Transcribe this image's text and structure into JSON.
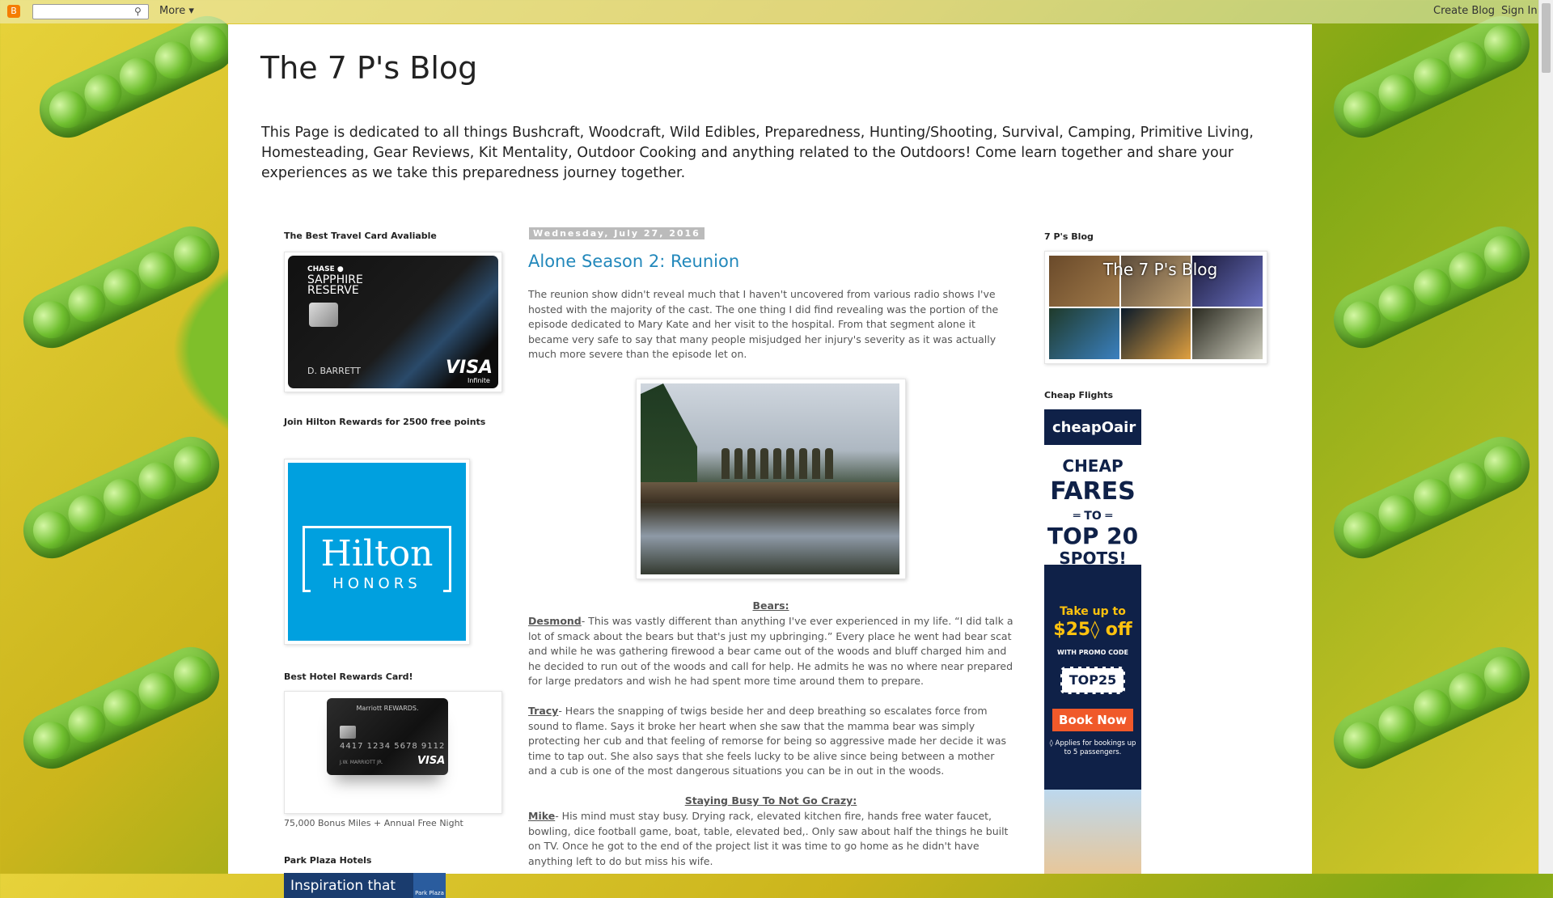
{
  "navbar": {
    "logo": "B",
    "more_label": "More ▾",
    "create_blog": "Create Blog",
    "sign_in": "Sign In",
    "search_icon": "search-icon"
  },
  "header": {
    "title": "The 7 P's Blog",
    "description": "This Page is dedicated to all things Bushcraft, Woodcraft, Wild Edibles, Preparedness, Hunting/Shooting, Survival, Camping, Primitive Living, Homesteading, Gear Reviews, Kit Mentality, Outdoor Cooking and anything related to the Outdoors! Come learn together and share your experiences as we take this preparedness journey together."
  },
  "left_sidebar": {
    "travel_title": "The Best Travel Card Avaliable",
    "chase": {
      "brand": "CHASE ●",
      "name_line1": "SAPPHIRE",
      "name_line2": "RESERVE",
      "holder": "D. BARRETT",
      "visa": "VISA",
      "tier": "Infinite"
    },
    "hilton_title": "Join Hilton Rewards for 2500 free points",
    "hilton": {
      "word": "Hilton",
      "sub": "HONORS"
    },
    "hotel_title": "Best Hotel Rewards Card!",
    "marriott": {
      "brand": "Marriott REWARDS.",
      "number": "4417 1234 5678 9112",
      "holder": "J.W. MARRIOTT JR.",
      "visa": "VISA"
    },
    "hotel_caption": "75,000 Bonus Miles + Annual Free Night",
    "park_title": "Park Plaza Hotels",
    "park_banner": "Inspiration that",
    "park_logo": "Park Plaza"
  },
  "post": {
    "date": "Wednesday, July 27, 2016",
    "title": "Alone Season 2: Reunion",
    "intro": "The reunion show didn't reveal much that I haven't uncovered from various radio shows I've hosted with the majority of the cast. The one thing I did find revealing was the portion of the episode dedicated to Mary Kate and her visit to the hospital. From that segment alone it became very safe to say that many people misjudged her injury's severity as it was actually much more severe than the episode let on.",
    "section_bears": "Bears:",
    "desmond_name": "Desmond",
    "desmond_text": "- This was vastly different than anything I've ever experienced in my life. “I did talk a lot of smack about the bears but that's just my upbringing.” Every place he went had bear scat and while he was gathering firewood a bear came out of the woods and bluff charged him and he decided to run out of the woods and call for help. He admits he was no where near prepared for large predators and wish he had spent more time around them to prepare.",
    "tracy_name": "Tracy",
    "tracy_text": "- Hears the snapping of twigs beside her and deep breathing so escalates force from sound to flame. Says it broke her heart when she saw that the mamma bear was simply protecting her cub and that feeling of remorse for being so aggressive made her decide it was time to tap out. She also says that she feels lucky to be alive since being between a mother and a cub is one of the most dangerous situations you can be in out in the woods.",
    "section_busy": "Staying Busy To Not Go Crazy:",
    "mike_name": "Mike",
    "mike_text": "- His mind must stay busy. Drying rack, elevated kitchen fire, hands free water faucet, bowling, dice football game, boat, table, elevated bed,. Only saw about half the things he built on TV. Once he got to the end of the project list it was time to go home as he didn't have anything left to do but miss his wife."
  },
  "right_sidebar": {
    "blog_title": "7 P's Blog",
    "blog_image_label": "The 7 P's Blog",
    "flights_title": "Cheap Flights",
    "cheapoair": {
      "logo": "cheapOair",
      "cheap": "CHEAP",
      "fares": "FARES",
      "to": "═ TO ═",
      "top20": "TOP 20",
      "spots": "SPOTS!",
      "take": "Take up to",
      "off": "$25◊ off",
      "with_code": "WITH PROMO CODE",
      "code": "TOP25",
      "book": "Book Now",
      "note": "◊ Applies for bookings up to 5 passengers."
    }
  }
}
